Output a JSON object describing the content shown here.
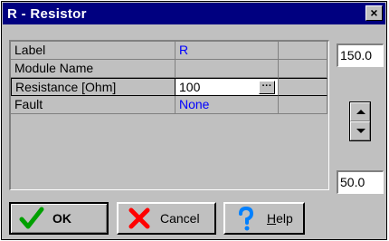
{
  "window": {
    "title": "R - Resistor",
    "close_glyph": "×"
  },
  "grid": {
    "rows": [
      {
        "label": "Label",
        "value": "R"
      },
      {
        "label": "Module Name",
        "value": ""
      },
      {
        "label": "Resistance [Ohm]",
        "value": "100",
        "selected": true,
        "ellipsis": "···"
      },
      {
        "label": "Fault",
        "value": "None"
      }
    ]
  },
  "spinner": {
    "max_value": "150.0",
    "min_value": "50.0"
  },
  "buttons": {
    "ok": {
      "label": "OK",
      "icon": "checkmark-icon"
    },
    "cancel": {
      "label": "Cancel",
      "icon": "x-mark-icon"
    },
    "help": {
      "label_underlined": "H",
      "label_rest": "elp",
      "icon": "question-mark-icon"
    }
  },
  "colors": {
    "title_bar": "#000080",
    "face": "#c0c0c0",
    "value_text": "#0000ff",
    "ok_icon": "#00a000",
    "cancel_icon": "#ff0000",
    "help_icon": "#0080ff"
  }
}
